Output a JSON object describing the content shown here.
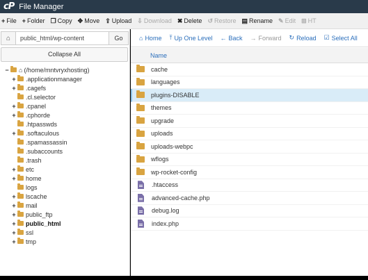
{
  "app": {
    "logo": "cP",
    "title": "File Manager"
  },
  "toolbar": [
    {
      "icon": "+",
      "label": "File",
      "enabled": true
    },
    {
      "icon": "+",
      "label": "Folder",
      "enabled": true
    },
    {
      "icon": "❐",
      "label": "Copy",
      "enabled": true
    },
    {
      "icon": "✥",
      "label": "Move",
      "enabled": true
    },
    {
      "icon": "⇪",
      "label": "Upload",
      "enabled": true
    },
    {
      "icon": "⇩",
      "label": "Download",
      "enabled": false
    },
    {
      "icon": "✖",
      "label": "Delete",
      "enabled": true
    },
    {
      "icon": "↺",
      "label": "Restore",
      "enabled": false
    },
    {
      "icon": "▤",
      "label": "Rename",
      "enabled": true
    },
    {
      "icon": "✎",
      "label": "Edit",
      "enabled": false
    },
    {
      "icon": "⊞",
      "label": "HT",
      "enabled": false
    }
  ],
  "left": {
    "path_value": "public_html/wp-content",
    "go_label": "Go",
    "collapse_label": "Collapse All",
    "tree": [
      {
        "toggle": "−",
        "label": "(/home/mntvryxhosting)",
        "indent": 0,
        "home": true,
        "bold": false
      },
      {
        "toggle": "+",
        "label": ".applicationmanager",
        "indent": 1,
        "bold": false
      },
      {
        "toggle": "+",
        "label": ".cagefs",
        "indent": 1,
        "bold": false
      },
      {
        "toggle": "",
        "label": ".cl.selector",
        "indent": 1,
        "bold": false
      },
      {
        "toggle": "+",
        "label": ".cpanel",
        "indent": 1,
        "bold": false
      },
      {
        "toggle": "+",
        "label": ".cphorde",
        "indent": 1,
        "bold": false
      },
      {
        "toggle": "",
        "label": ".htpasswds",
        "indent": 1,
        "bold": false
      },
      {
        "toggle": "+",
        "label": ".softaculous",
        "indent": 1,
        "bold": false
      },
      {
        "toggle": "",
        "label": ".spamassassin",
        "indent": 1,
        "bold": false
      },
      {
        "toggle": "",
        "label": ".subaccounts",
        "indent": 1,
        "bold": false
      },
      {
        "toggle": "",
        "label": ".trash",
        "indent": 1,
        "bold": false
      },
      {
        "toggle": "+",
        "label": "etc",
        "indent": 1,
        "bold": false
      },
      {
        "toggle": "+",
        "label": "home",
        "indent": 1,
        "bold": false
      },
      {
        "toggle": "",
        "label": "logs",
        "indent": 1,
        "bold": false
      },
      {
        "toggle": "+",
        "label": "lscache",
        "indent": 1,
        "bold": false
      },
      {
        "toggle": "+",
        "label": "mail",
        "indent": 1,
        "bold": false
      },
      {
        "toggle": "+",
        "label": "public_ftp",
        "indent": 1,
        "bold": false
      },
      {
        "toggle": "+",
        "label": "public_html",
        "indent": 1,
        "bold": true
      },
      {
        "toggle": "+",
        "label": "ssl",
        "indent": 1,
        "bold": false
      },
      {
        "toggle": "+",
        "label": "tmp",
        "indent": 1,
        "bold": false
      }
    ]
  },
  "nav": [
    {
      "icon": "⌂",
      "label": "Home",
      "enabled": true
    },
    {
      "icon": "⤒",
      "label": "Up One Level",
      "enabled": true
    },
    {
      "icon": "←",
      "label": "Back",
      "enabled": true
    },
    {
      "icon": "→",
      "label": "Forward",
      "enabled": false
    },
    {
      "icon": "↻",
      "label": "Reload",
      "enabled": true
    },
    {
      "icon": "☑",
      "label": "Select All",
      "enabled": true
    }
  ],
  "columns": {
    "name": "Name"
  },
  "files": [
    {
      "name": "cache",
      "type": "folder",
      "selected": false
    },
    {
      "name": "languages",
      "type": "folder",
      "selected": false
    },
    {
      "name": "plugins-DISABLE",
      "type": "folder",
      "selected": true
    },
    {
      "name": "themes",
      "type": "folder",
      "selected": false
    },
    {
      "name": "upgrade",
      "type": "folder",
      "selected": false
    },
    {
      "name": "uploads",
      "type": "folder",
      "selected": false
    },
    {
      "name": "uploads-webpc",
      "type": "folder",
      "selected": false
    },
    {
      "name": "wflogs",
      "type": "folder",
      "selected": false
    },
    {
      "name": "wp-rocket-config",
      "type": "folder",
      "selected": false
    },
    {
      "name": ".htaccess",
      "type": "file",
      "selected": false
    },
    {
      "name": "advanced-cache.php",
      "type": "file",
      "selected": false
    },
    {
      "name": "debug.log",
      "type": "file",
      "selected": false
    },
    {
      "name": "index.php",
      "type": "file",
      "selected": false
    }
  ]
}
